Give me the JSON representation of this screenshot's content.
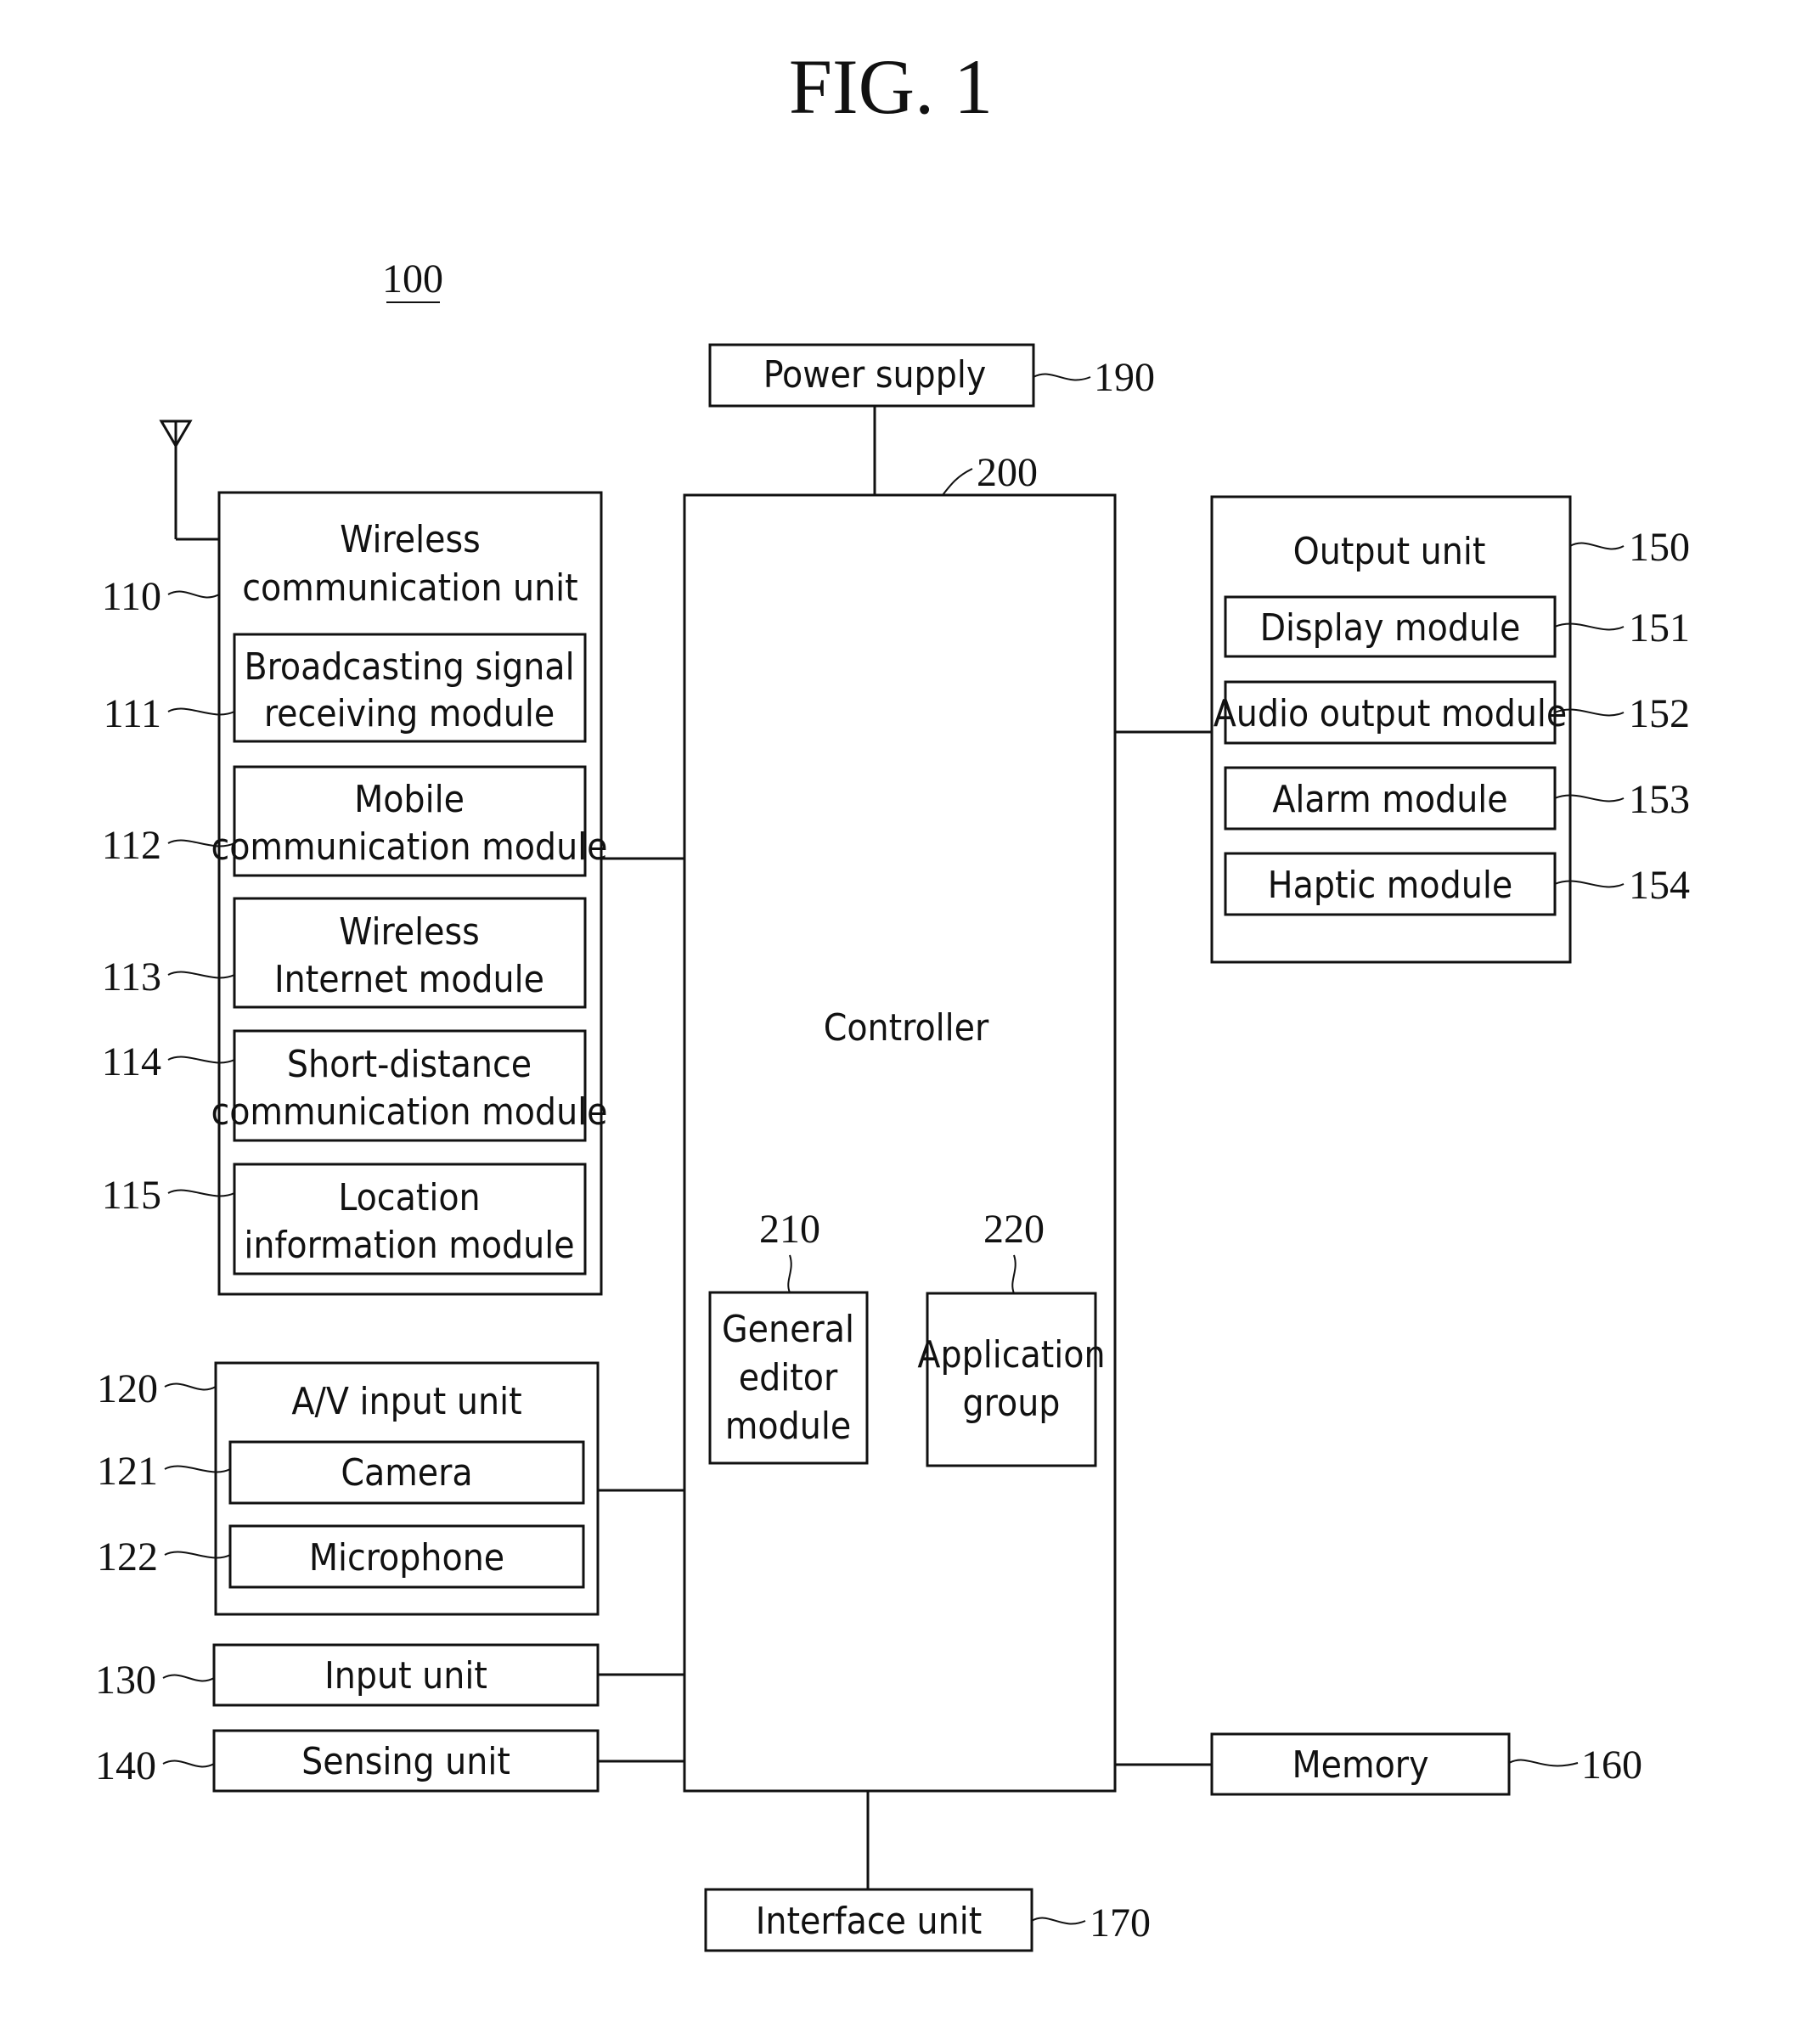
{
  "figure": {
    "title": "FIG. 1",
    "device_ref": "100"
  },
  "blocks": {
    "power_supply": {
      "label": [
        "Power supply"
      ],
      "ref": "190"
    },
    "controller": {
      "label": [
        "Controller"
      ],
      "ref": "200"
    },
    "wireless_unit": {
      "label": [
        "Wireless",
        "communication unit"
      ],
      "ref": "110"
    },
    "broadcasting": {
      "label": [
        "Broadcasting signal",
        "receiving module"
      ],
      "ref": "111"
    },
    "mobile_comm": {
      "label": [
        "Mobile",
        "communication module"
      ],
      "ref": "112"
    },
    "wireless_internet": {
      "label": [
        "Wireless",
        "Internet module"
      ],
      "ref": "113"
    },
    "short_distance": {
      "label": [
        "Short-distance",
        "communication module"
      ],
      "ref": "114"
    },
    "location": {
      "label": [
        "Location",
        "information module"
      ],
      "ref": "115"
    },
    "av_input": {
      "label": [
        "A/V input unit"
      ],
      "ref": "120"
    },
    "camera": {
      "label": [
        "Camera"
      ],
      "ref": "121"
    },
    "microphone": {
      "label": [
        "Microphone"
      ],
      "ref": "122"
    },
    "input_unit": {
      "label": [
        "Input unit"
      ],
      "ref": "130"
    },
    "sensing_unit": {
      "label": [
        "Sensing unit"
      ],
      "ref": "140"
    },
    "output_unit": {
      "label": [
        "Output unit"
      ],
      "ref": "150"
    },
    "display_module": {
      "label": [
        "Display module"
      ],
      "ref": "151"
    },
    "audio_output": {
      "label": [
        "Audio output module"
      ],
      "ref": "152"
    },
    "alarm_module": {
      "label": [
        "Alarm module"
      ],
      "ref": "153"
    },
    "haptic_module": {
      "label": [
        "Haptic module"
      ],
      "ref": "154"
    },
    "memory": {
      "label": [
        "Memory"
      ],
      "ref": "160"
    },
    "interface_unit": {
      "label": [
        "Interface unit"
      ],
      "ref": "170"
    },
    "general_editor": {
      "label": [
        "General",
        "editor",
        "module"
      ],
      "ref": "210"
    },
    "application_group": {
      "label": [
        "Application",
        "group"
      ],
      "ref": "220"
    }
  },
  "icons": {
    "antenna": "antenna-icon"
  }
}
